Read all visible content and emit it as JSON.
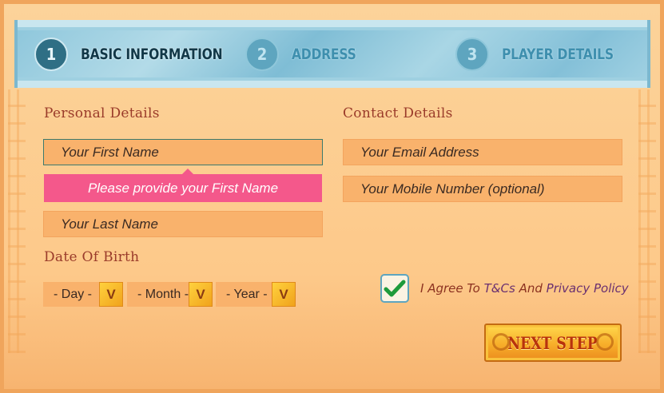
{
  "steps": [
    {
      "number": "1",
      "label": "BASIC INFORMATION",
      "state": "active"
    },
    {
      "number": "2",
      "label": "ADDRESS",
      "state": "inactive"
    },
    {
      "number": "3",
      "label": "PLAYER DETAILS",
      "state": "inactive"
    }
  ],
  "personal": {
    "title": "Personal Details",
    "first_name_placeholder": "Your First Name",
    "first_name_error": "Please provide your First Name",
    "last_name_placeholder": "Your Last Name"
  },
  "contact": {
    "title": "Contact Details",
    "email_placeholder": "Your Email Address",
    "mobile_placeholder": "Your Mobile Number (optional)"
  },
  "dob": {
    "title": "Date Of Birth",
    "day": "- Day -",
    "month": "- Month -",
    "year": "- Year -",
    "arrow_glyph": "V"
  },
  "agreement": {
    "checked": true,
    "prefix": "I Agree To",
    "tcs_link": "T&Cs",
    "and": "And",
    "privacy_link": "Privacy Policy"
  },
  "next_button": {
    "label": "NEXT STEP"
  },
  "colors": {
    "accent_red": "#9a3b2a",
    "error_pink": "#f4588b",
    "field_bg": "#f9b26c",
    "banner_blue": "#8dc6db"
  }
}
